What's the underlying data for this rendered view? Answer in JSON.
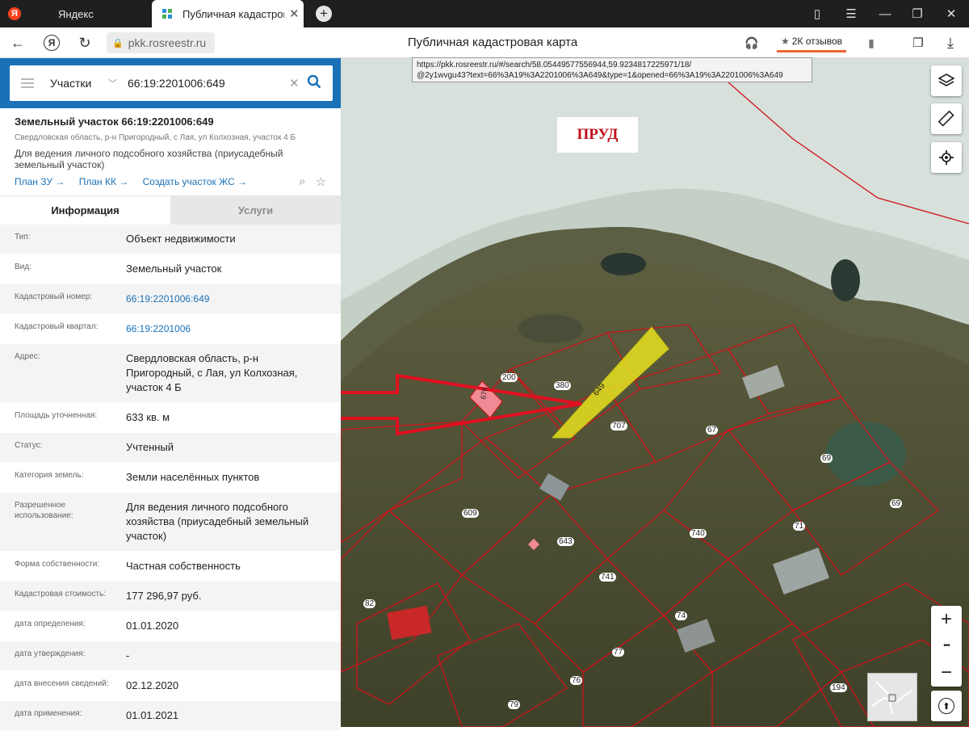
{
  "browser": {
    "tabs": [
      {
        "label": "Яндекс"
      },
      {
        "label": "Публичная кадастрова"
      }
    ],
    "yandex_fav": "Я",
    "url": "pkk.rosreestr.ru",
    "page_title": "Публичная кадастровая карта",
    "reviews": "2К отзывов",
    "url_tooltip_line1": "https://pkk.rosreestr.ru/#/search/58.05449577556944,59.9234817225971/18/",
    "url_tooltip_line2": "@2y1wvgu43?text=66%3A19%3A2201006%3A649&type=1&opened=66%3A19%3A2201006%3A649"
  },
  "search": {
    "type": "Участки",
    "value": "66:19:2201006:649"
  },
  "object": {
    "title": "Земельный участок 66:19:2201006:649",
    "address_short": "Свердловская область, р-н Пригородный, с Лая, ул Колхозная, участок 4 Б",
    "use": "Для ведения личного подсобного хозяйства (приусадебный земельный участок)",
    "links": [
      "План ЗУ →",
      "План КК →",
      "Создать участок ЖС →"
    ]
  },
  "info_tabs": {
    "info": "Информация",
    "services": "Услуги"
  },
  "rows": [
    {
      "k": "Тип:",
      "v": "Объект недвижимости"
    },
    {
      "k": "Вид:",
      "v": "Земельный участок"
    },
    {
      "k": "Кадастровый номер:",
      "v": "66:19:2201006:649"
    },
    {
      "k": "Кадастровый квартал:",
      "v": "66:19:2201006"
    },
    {
      "k": "Адрес:",
      "v": "Свердловская область, р-н Пригородный, с Лая, ул Колхозная, участок 4 Б"
    },
    {
      "k": "Площадь уточненная:",
      "v": "633 кв. м"
    },
    {
      "k": "Статус:",
      "v": "Учтенный"
    },
    {
      "k": "Категория земель:",
      "v": "Земли населённых пунктов"
    },
    {
      "k": "Разрешенное использование:",
      "v": "Для ведения личного подсобного хозяйства (приусадебный земельный участок)"
    },
    {
      "k": "Форма собственности:",
      "v": "Частная собственность"
    },
    {
      "k": "Кадастровая стоимость:",
      "v": "177 296,97 руб."
    },
    {
      "k": "дата определения:",
      "v": "01.01.2020"
    },
    {
      "k": "дата утверждения:",
      "v": "-"
    },
    {
      "k": "дата внесения сведений:",
      "v": "02.12.2020"
    },
    {
      "k": "дата применения:",
      "v": "01.01.2021"
    }
  ],
  "map": {
    "pond_label": "ПРУД",
    "parcels": [
      {
        "label": "649"
      },
      {
        "label": "200"
      },
      {
        "label": "380"
      },
      {
        "label": "707"
      },
      {
        "label": "67"
      },
      {
        "label": "69"
      },
      {
        "label": "69"
      },
      {
        "label": "609"
      },
      {
        "label": "643"
      },
      {
        "label": "740"
      },
      {
        "label": "71"
      },
      {
        "label": "741"
      },
      {
        "label": "74"
      },
      {
        "label": "77"
      },
      {
        "label": "76"
      },
      {
        "label": "79"
      },
      {
        "label": "82"
      },
      {
        "label": "194"
      },
      {
        "label": "679"
      }
    ],
    "zoom_in": "+",
    "zoom_more": "•••",
    "zoom_out": "−"
  },
  "colors": {
    "header_blue": "#1a71b8",
    "parcel_border": "#d0121b",
    "selected_parcel": "#e8e21e",
    "arrow": "#e01020"
  }
}
